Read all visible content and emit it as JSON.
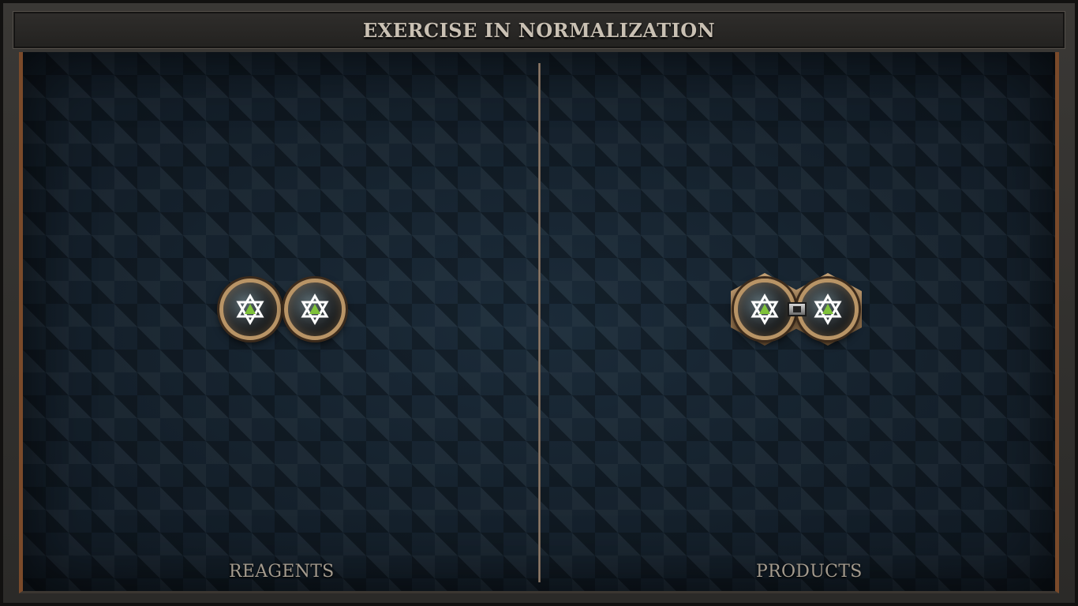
{
  "window": {
    "title": "EXERCISE IN NORMALIZATION"
  },
  "panels": {
    "reagents": {
      "label": "REAGENTS",
      "sockets": [
        "green-star-socket",
        "green-star-socket"
      ]
    },
    "products": {
      "label": "PRODUCTS",
      "sockets": [
        "green-star-socket",
        "green-star-socket"
      ],
      "linked": true
    }
  },
  "colors": {
    "frame_accent": "#7a4a2a",
    "title_text": "#c9c0b3",
    "label_text": "#a49b8e",
    "board_background": "#14202b",
    "socket_rim": "#b89466",
    "gem_core": "#7fc23a"
  }
}
